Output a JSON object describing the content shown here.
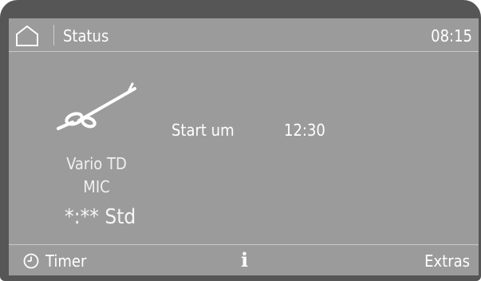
{
  "header": {
    "title": "Status",
    "clock": "08:15",
    "home_icon": "home-icon"
  },
  "program": {
    "icon": "instrument-icon",
    "name": "Vario TD",
    "subtitle": "MIC",
    "duration": "*:** Std"
  },
  "start": {
    "label": "Start um",
    "time": "12:30"
  },
  "footer": {
    "timer_label": "Timer",
    "timer_icon": "clock-icon",
    "info_icon": "info-icon",
    "info_label": "i",
    "extras_label": "Extras"
  },
  "colors": {
    "screen_bg": "#9b9b9b",
    "bezel": "#565656",
    "text": "#ffffff",
    "divider": "#c8c8c8"
  }
}
